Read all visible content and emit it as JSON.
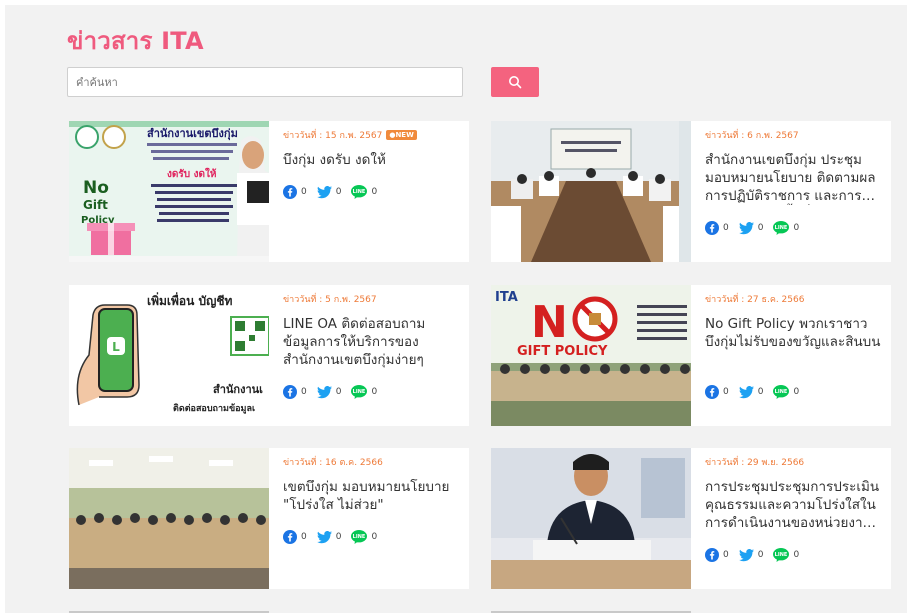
{
  "header": {
    "title": "ข่าวสาร ITA"
  },
  "search": {
    "placeholder": "คำค้นหา"
  },
  "colors": {
    "accent": "#f4637f",
    "title": "#ef5a7e",
    "date": "#ee7a38",
    "facebook": "#1b74e4",
    "twitter": "#1da1f2",
    "line": "#06c755"
  },
  "share_icons": [
    "facebook-icon",
    "twitter-icon",
    "line-icon"
  ],
  "news": [
    {
      "date": "ข่าววันที่ : 15 ก.พ. 2567",
      "badge": "NEW",
      "title": "บึงกุ่ม งดรับ งดให้",
      "counts": {
        "facebook": "0",
        "twitter": "0",
        "line": "0"
      },
      "image_text": {
        "line1": "สำนักงานเขตบึงกุ่ม",
        "line2": "งดรับ งดให้",
        "line3": "No",
        "line4": "Gift",
        "line5": "Policy"
      }
    },
    {
      "date": "ข่าววันที่ : 6 ก.พ. 2567",
      "badge": "",
      "title": "สำนักงานเขตบึงกุ่ม ประชุมมอบหมายนโยบาย ติดตามผลการปฏิบัติราชการ และการดำเนินงานในพื้นที่",
      "counts": {
        "facebook": "0",
        "twitter": "0",
        "line": "0"
      }
    },
    {
      "date": "ข่าววันที่ : 5 ก.พ. 2567",
      "badge": "",
      "title": "LINE OA ติดต่อสอบถามข้อมูลการให้บริการของสำนักงานเขตบึงกุ่มง่ายๆ",
      "counts": {
        "facebook": "0",
        "twitter": "0",
        "line": "0"
      },
      "image_text": {
        "line1": "เพิ่มเพื่อน บัญชีท",
        "line2": "สำนักงานเ",
        "line3": "ติดต่อสอบถามข้อมูลเ"
      }
    },
    {
      "date": "ข่าววันที่ : 27 ธ.ค. 2566",
      "badge": "",
      "title": "No Gift Policy พวกเราชาวบึงกุ่มไม่รับของขวัญและสินบน",
      "counts": {
        "facebook": "0",
        "twitter": "0",
        "line": "0"
      },
      "image_text": {
        "line1": "ITA",
        "line2": "N",
        "line3": "GIFT POLICY"
      }
    },
    {
      "date": "ข่าววันที่ : 16 ต.ค. 2566",
      "badge": "",
      "title": "เขตบึงกุ่ม มอบหมายนโยบาย \"โปร่งใส ไม่ส่วย\"",
      "counts": {
        "facebook": "0",
        "twitter": "0",
        "line": "0"
      }
    },
    {
      "date": "ข่าววันที่ : 29 พ.ย. 2566",
      "badge": "",
      "title": "การประชุมประชุมการประเมินคุณธรรมและความโปร่งใสในการดำเนินงานของหน่วยงานภาครัฐ",
      "counts": {
        "facebook": "0",
        "twitter": "0",
        "line": "0"
      }
    }
  ]
}
